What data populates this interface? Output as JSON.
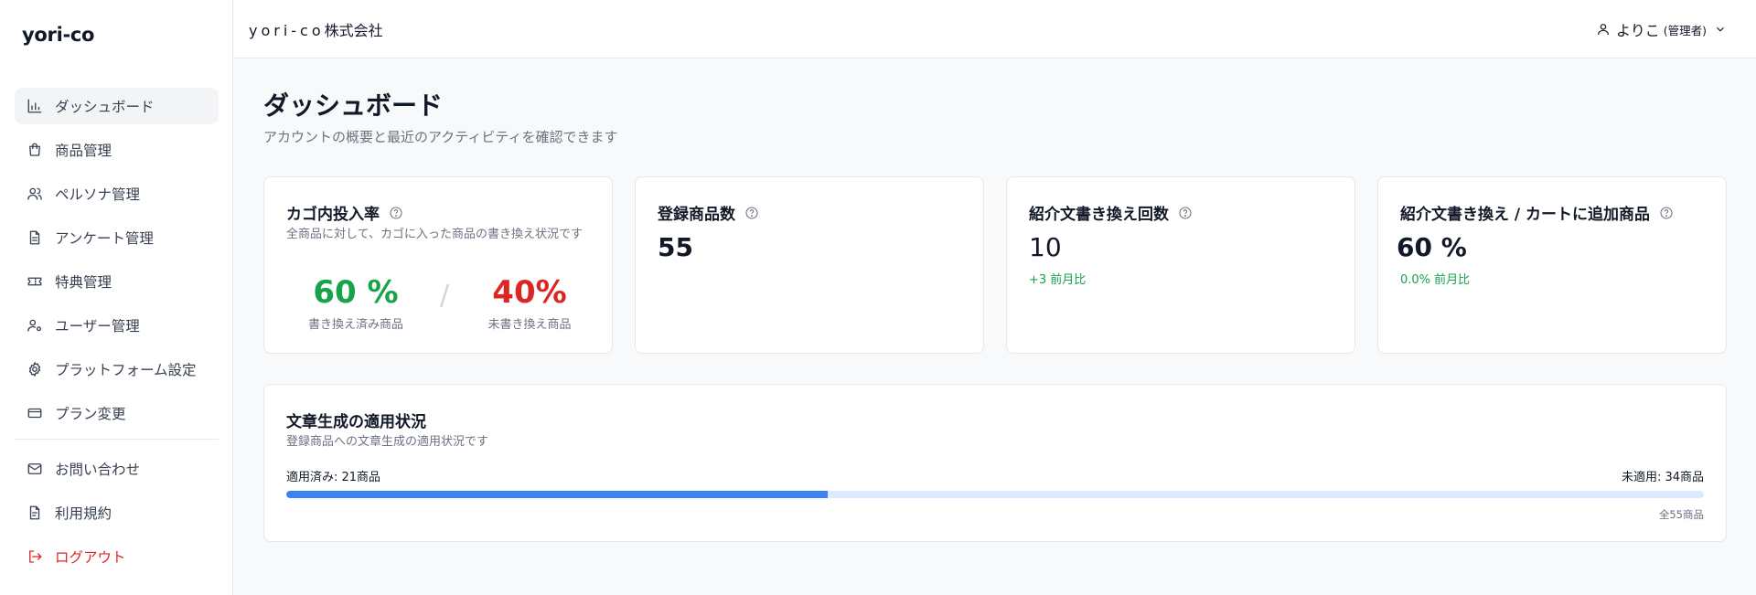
{
  "sidebar": {
    "brand": "yori-co",
    "items": [
      {
        "label": "ダッシュボード",
        "icon": "bar-chart-icon"
      },
      {
        "label": "商品管理",
        "icon": "shopping-bag-icon"
      },
      {
        "label": "ペルソナ管理",
        "icon": "users-icon"
      },
      {
        "label": "アンケート管理",
        "icon": "file-text-icon"
      },
      {
        "label": "特典管理",
        "icon": "ticket-icon"
      },
      {
        "label": "ユーザー管理",
        "icon": "user-cog-icon"
      },
      {
        "label": "プラットフォーム設定",
        "icon": "gear-icon"
      },
      {
        "label": "プラン変更",
        "icon": "credit-card-icon"
      }
    ],
    "footer_items": [
      {
        "label": "お問い合わせ",
        "icon": "mail-icon"
      },
      {
        "label": "利用規約",
        "icon": "document-icon"
      },
      {
        "label": "ログアウト",
        "icon": "logout-icon"
      }
    ]
  },
  "header": {
    "company_latin": "yori-co",
    "company_suffix": "株式会社",
    "user_name": "よりこ",
    "user_role": "(管理者)"
  },
  "main": {
    "title": "ダッシュボード",
    "subtitle": "アカウントの概要と最近のアクティビティを確認できます",
    "cards": {
      "cart_rate": {
        "title": "カゴ内投入率",
        "description": "全商品に対して、カゴに入った商品の書き換え状況です",
        "rewritten_pct": "60 %",
        "rewritten_label": "書き換え済み商品",
        "separator": "/",
        "not_rewritten_pct": "40%",
        "not_rewritten_label": "未書き換え商品"
      },
      "registered": {
        "title": "登録商品数",
        "value": "55"
      },
      "rewrite_count": {
        "title": "紹介文書き換え回数",
        "value": "10",
        "delta": "+3 前月比"
      },
      "rewrite_ratio": {
        "title": "紹介文書き換え / カートに追加商品",
        "value": "60 %",
        "delta": "0.0% 前月比"
      }
    },
    "application": {
      "title": "文章生成の適用状況",
      "description": "登録商品への文章生成の適用状況です",
      "applied_label": "適用済み: 21商品",
      "unapplied_label": "未適用: 34商品",
      "total_label": "全55商品",
      "applied_fraction": 0.382
    }
  },
  "colors": {
    "accent_blue": "#3b82f6",
    "track_blue": "#dbeafe",
    "success_green": "#16a34a",
    "danger_red": "#dc2626"
  }
}
